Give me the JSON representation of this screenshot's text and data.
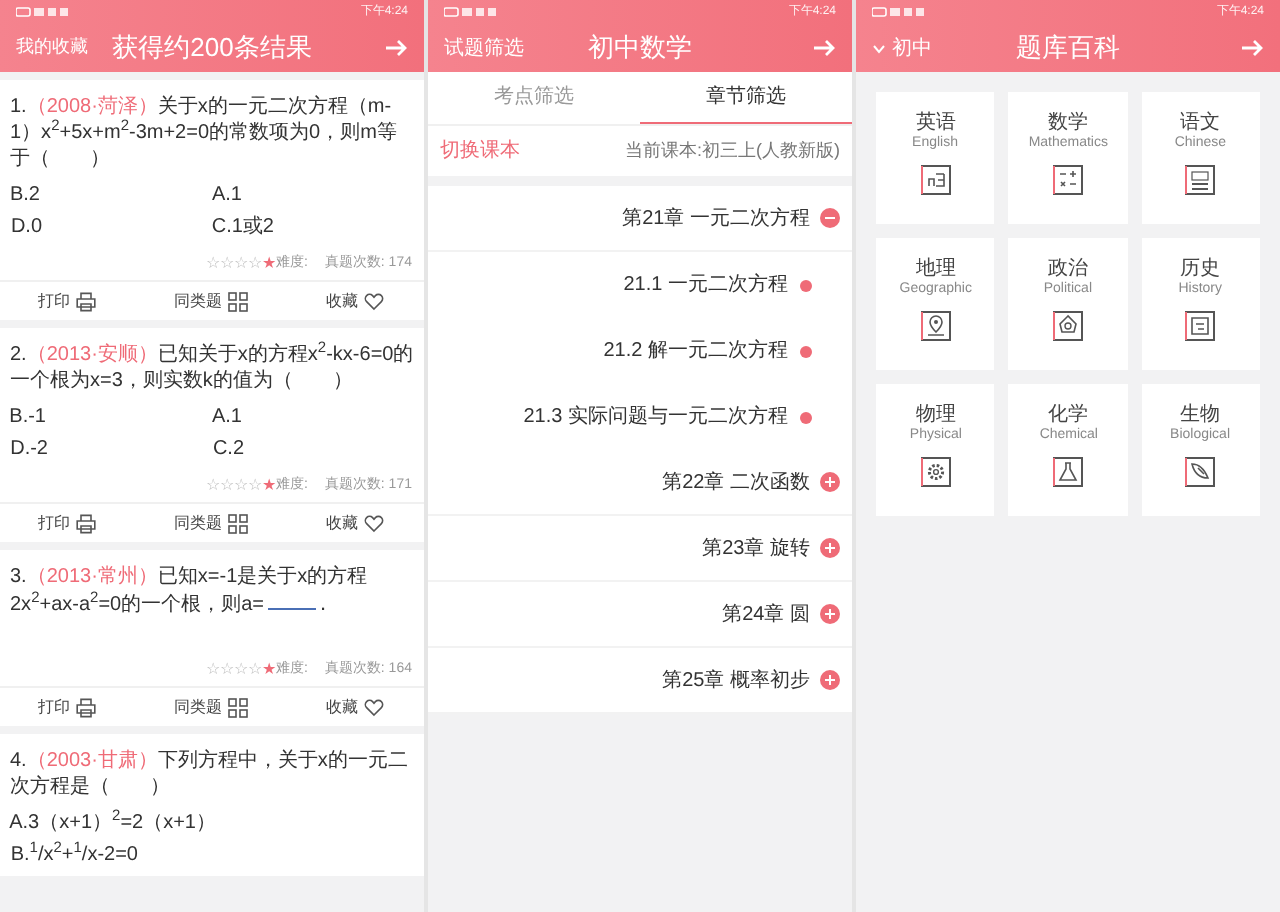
{
  "subjects_screen": {
    "status_time": "下午4:24",
    "title": "题库百科",
    "grade_selector": "初中",
    "subjects": [
      {
        "name": "英语",
        "english": "English"
      },
      {
        "name": "数学",
        "english": "Mathematics"
      },
      {
        "name": "语文",
        "english": "Chinese"
      },
      {
        "name": "地理",
        "english": "Geographic"
      },
      {
        "name": "政治",
        "english": "Political"
      },
      {
        "name": "历史",
        "english": "History"
      },
      {
        "name": "物理",
        "english": "Physical"
      },
      {
        "name": "化学",
        "english": "Chemical"
      },
      {
        "name": "生物",
        "english": "Biological"
      }
    ]
  },
  "chapters_screen": {
    "status_time": "下午4:24",
    "title": "初中数学",
    "header_action": "试题筛选",
    "tabs": [
      {
        "label": "考点筛选",
        "selected": false
      },
      {
        "label": "章节筛选",
        "selected": true
      }
    ],
    "current_textbook": "当前课本:初三上(人教新版)",
    "switch_textbook": "切换课本",
    "chapters": [
      {
        "label": "第21章 一元二次方程",
        "expanded": true,
        "children": [
          {
            "label": "21.1 一元二次方程"
          },
          {
            "label": "21.2 解一元二次方程"
          },
          {
            "label": "21.3 实际问题与一元二次方程"
          }
        ]
      },
      {
        "label": "第22章 二次函数",
        "expanded": false
      },
      {
        "label": "第23章 旋转",
        "expanded": false
      },
      {
        "label": "第24章 圆",
        "expanded": false
      },
      {
        "label": "第25章 概率初步",
        "expanded": false
      }
    ]
  },
  "results_screen": {
    "status_time": "下午4:24",
    "title": "获得约200条结果",
    "header_action": "我的收藏",
    "questions": [
      {
        "number": "1.",
        "source": "（2008·菏泽）",
        "text": "关于x的一元二次方程（m-1）x$^{2}$+5x+m$^{2}$-3m+2=0的常数项为0，则m等于（　　）",
        "options": [
          "B.2",
          "A.1",
          "D.0",
          "C.1或2"
        ],
        "count": "真题次数: 174",
        "difficulty": "难度:",
        "stars": 1,
        "actions": [
          "打印",
          "同类题",
          "收藏"
        ]
      },
      {
        "number": "2.",
        "source": "（2013·安顺）",
        "text": "已知关于x的方程x$^{2}$-kx-6=0的一个根为x=3，则实数k的值为（　　）",
        "options": [
          "B.-1",
          "A.1",
          "D.-2",
          "C.2"
        ],
        "count": "真题次数: 171",
        "difficulty": "难度:",
        "stars": 1,
        "actions": [
          "打印",
          "同类题",
          "收藏"
        ]
      },
      {
        "number": "3.",
        "source": "（2013·常州）",
        "text": "已知x=-1是关于x的方程2x$^{2}$+ax-a$^{2}$=0的一个根，则a=",
        "blank": true,
        "end": ".",
        "count": "真题次数: 164",
        "difficulty": "难度:",
        "stars": 1,
        "actions": [
          "打印",
          "同类题",
          "收藏"
        ]
      },
      {
        "number": "4.",
        "source": "（2003·甘肃）",
        "text": "下列方程中，关于x的一元二次方程是（　　）",
        "options": [
          "A.3（x+1）$^{2}$=2（x+1）",
          "B.$^{1}$/x$^{2}$+$^{1}$/x-2=0"
        ]
      }
    ]
  }
}
